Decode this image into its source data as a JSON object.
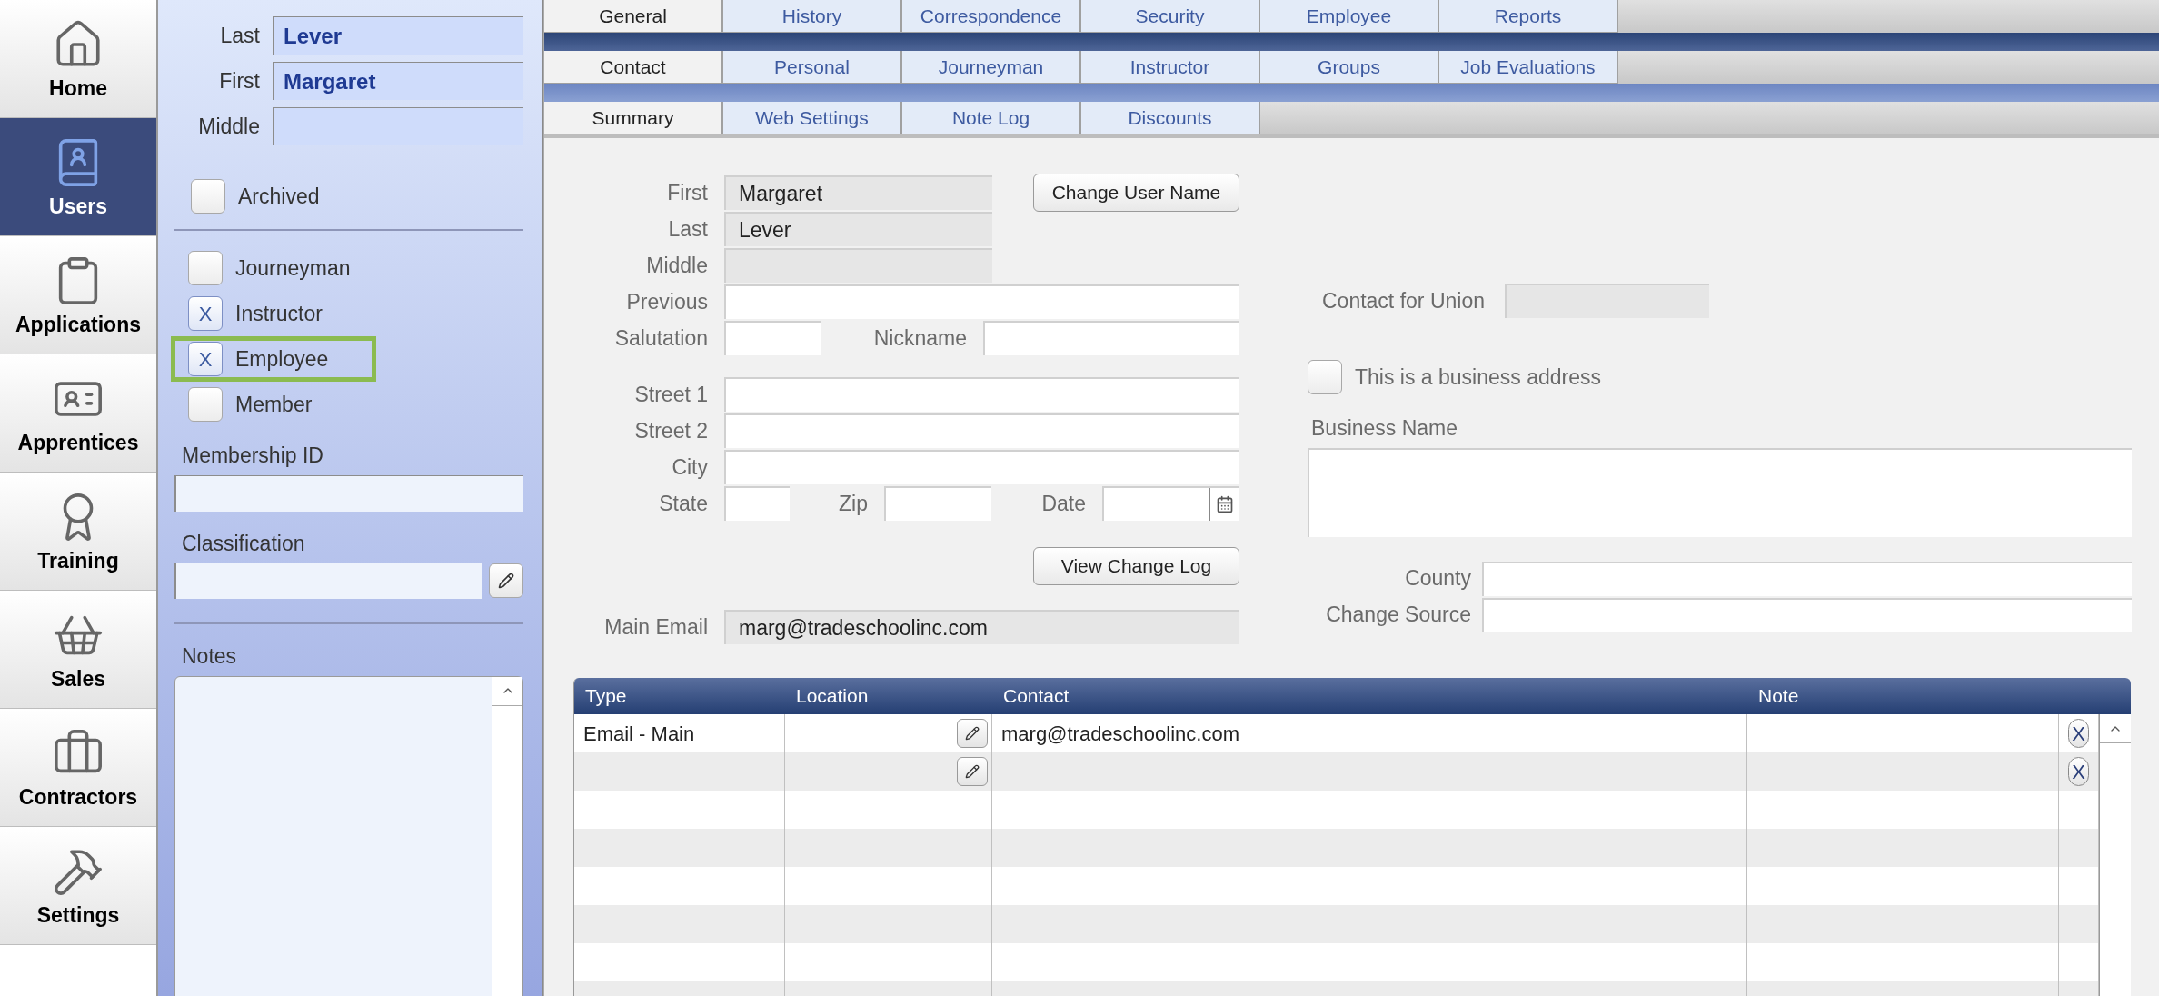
{
  "nav": {
    "items": [
      {
        "label": "Home",
        "selected": false
      },
      {
        "label": "Users",
        "selected": true
      },
      {
        "label": "Applications",
        "selected": false
      },
      {
        "label": "Apprentices",
        "selected": false
      },
      {
        "label": "Training",
        "selected": false
      },
      {
        "label": "Sales",
        "selected": false
      },
      {
        "label": "Contractors",
        "selected": false
      },
      {
        "label": "Settings",
        "selected": false
      }
    ]
  },
  "user_panel": {
    "name_fields": [
      {
        "label": "Last",
        "value": "Lever"
      },
      {
        "label": "First",
        "value": "Margaret"
      },
      {
        "label": "Middle"
      }
    ],
    "archived": {
      "label": "Archived",
      "checked": false
    },
    "roles": [
      {
        "label": "Journeyman",
        "checked": false,
        "highlighted": false
      },
      {
        "label": "Instructor",
        "checked": true,
        "mark": "X",
        "highlighted": false
      },
      {
        "label": "Employee",
        "checked": true,
        "mark": "X",
        "highlighted": true
      },
      {
        "label": "Member",
        "checked": false,
        "highlighted": false
      }
    ],
    "membership_id": {
      "label": "Membership ID"
    },
    "classification": {
      "label": "Classification"
    },
    "notes": {
      "label": "Notes"
    }
  },
  "tab_rows": [
    [
      {
        "label": "General",
        "selected": true
      },
      {
        "label": "History",
        "selected": false
      },
      {
        "label": "Correspondence",
        "selected": false
      },
      {
        "label": "Security",
        "selected": false
      },
      {
        "label": "Employee",
        "selected": false
      },
      {
        "label": "Reports",
        "selected": false
      }
    ],
    [
      {
        "label": "Contact",
        "selected": true
      },
      {
        "label": "Personal",
        "selected": false
      },
      {
        "label": "Journeyman",
        "selected": false
      },
      {
        "label": "Instructor",
        "selected": false
      },
      {
        "label": "Groups",
        "selected": false
      },
      {
        "label": "Job Evaluations",
        "selected": false
      }
    ],
    [
      {
        "label": "Summary",
        "selected": true
      },
      {
        "label": "Web Settings",
        "selected": false
      },
      {
        "label": "Note Log",
        "selected": false
      },
      {
        "label": "Discounts",
        "selected": false
      }
    ]
  ],
  "summary": {
    "first": {
      "label": "First",
      "value": "Margaret"
    },
    "last": {
      "label": "Last",
      "value": "Lever"
    },
    "middle": {
      "label": "Middle"
    },
    "change_user_name_button": "Change User Name",
    "previous": {
      "label": "Previous"
    },
    "salutation": {
      "label": "Salutation"
    },
    "nickname": {
      "label": "Nickname"
    },
    "street_1": {
      "label": "Street 1"
    },
    "street_2": {
      "label": "Street 2"
    },
    "city": {
      "label": "City"
    },
    "state": {
      "label": "State"
    },
    "zip": {
      "label": "Zip"
    },
    "date": {
      "label": "Date"
    },
    "view_change_log_button": "View Change Log",
    "main_email": {
      "label": "Main Email",
      "value": "marg@tradeschoolinc.com"
    },
    "contact_for_union": {
      "label": "Contact for Union"
    },
    "business_address": {
      "label": "This is a business address",
      "checked": false
    },
    "business_name": {
      "label": "Business Name"
    },
    "county": {
      "label": "County"
    },
    "change_source": {
      "label": "Change Source"
    }
  },
  "contacts_table": {
    "columns": [
      "Type",
      "Location",
      "Contact",
      "Note"
    ],
    "rows": [
      {
        "type": "Email - Main",
        "contact": "marg@tradeschoolinc.com",
        "editable": true,
        "remove_mark": "X"
      },
      {
        "editable": true,
        "remove_mark": "X"
      }
    ]
  }
}
